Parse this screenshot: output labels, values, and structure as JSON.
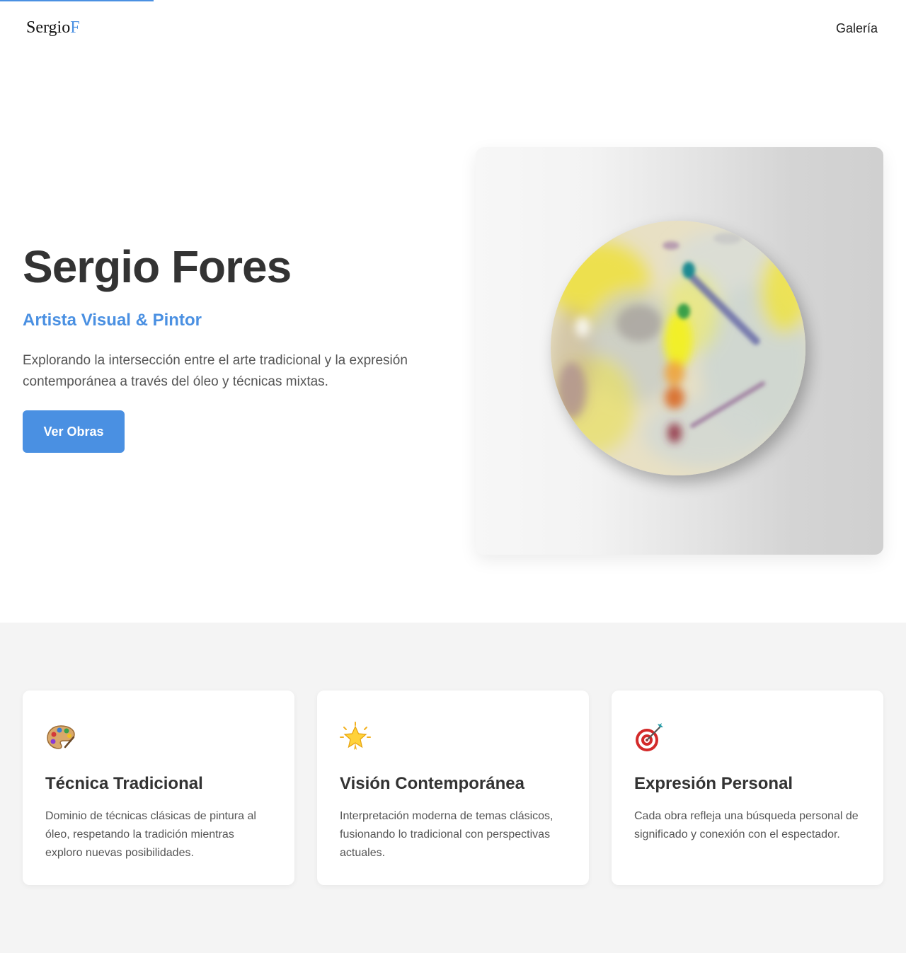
{
  "header": {
    "logo_main": "Sergio",
    "logo_accent": "F",
    "nav_gallery": "Galería"
  },
  "hero": {
    "title": "Sergio Fores",
    "subtitle": "Artista Visual & Pintor",
    "description": "Explorando la intersección entre el arte tradicional y la expresión contemporánea a través del óleo y técnicas mixtas.",
    "cta_label": "Ver Obras"
  },
  "features": {
    "cards": [
      {
        "icon": "palette-icon",
        "title": "Técnica Tradicional",
        "text": "Dominio de técnicas clásicas de pintura al óleo, respetando la tradición mientras exploro nuevas posibilidades."
      },
      {
        "icon": "glowing-star-icon",
        "title": "Visión Contemporánea",
        "text": "Interpretación moderna de temas clásicos, fusionando lo tradicional con perspectivas actuales."
      },
      {
        "icon": "target-icon",
        "title": "Expresión Personal",
        "text": "Cada obra refleja una búsqueda personal de significado y conexión con el espectador."
      }
    ]
  },
  "colors": {
    "accent": "#4a90e2",
    "text_dark": "#333333",
    "text_muted": "#555555",
    "section_bg": "#f4f4f4"
  }
}
